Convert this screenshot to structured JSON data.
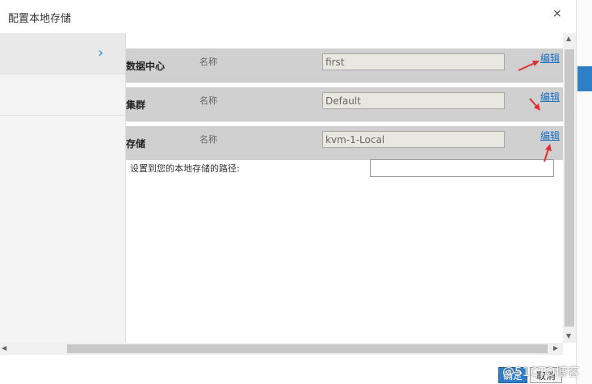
{
  "dialog": {
    "title": "配置本地存储",
    "close_label": "×"
  },
  "sidebar": {
    "chevron": "›"
  },
  "rows": [
    {
      "label": "数据中心",
      "name_label": "名称",
      "value": "first",
      "edit_label": "编辑"
    },
    {
      "label": "集群",
      "name_label": "名称",
      "value": "Default",
      "edit_label": "编辑"
    },
    {
      "label": "存储",
      "name_label": "名称",
      "value": "kvm-1-Local",
      "edit_label": "编辑"
    }
  ],
  "path": {
    "label": "设置到您的本地存储的路径:",
    "value": ""
  },
  "buttons": {
    "ok": "确定",
    "cancel": "取消"
  },
  "watermark": "@51CTO博客",
  "colors": {
    "accent": "#2f7fc8",
    "annotation": "#e03030",
    "link": "#1a6fc4"
  },
  "icons": {
    "close": "close-icon",
    "chevron": "chevron-right-icon",
    "arrow": "annotation-arrow-icon"
  }
}
